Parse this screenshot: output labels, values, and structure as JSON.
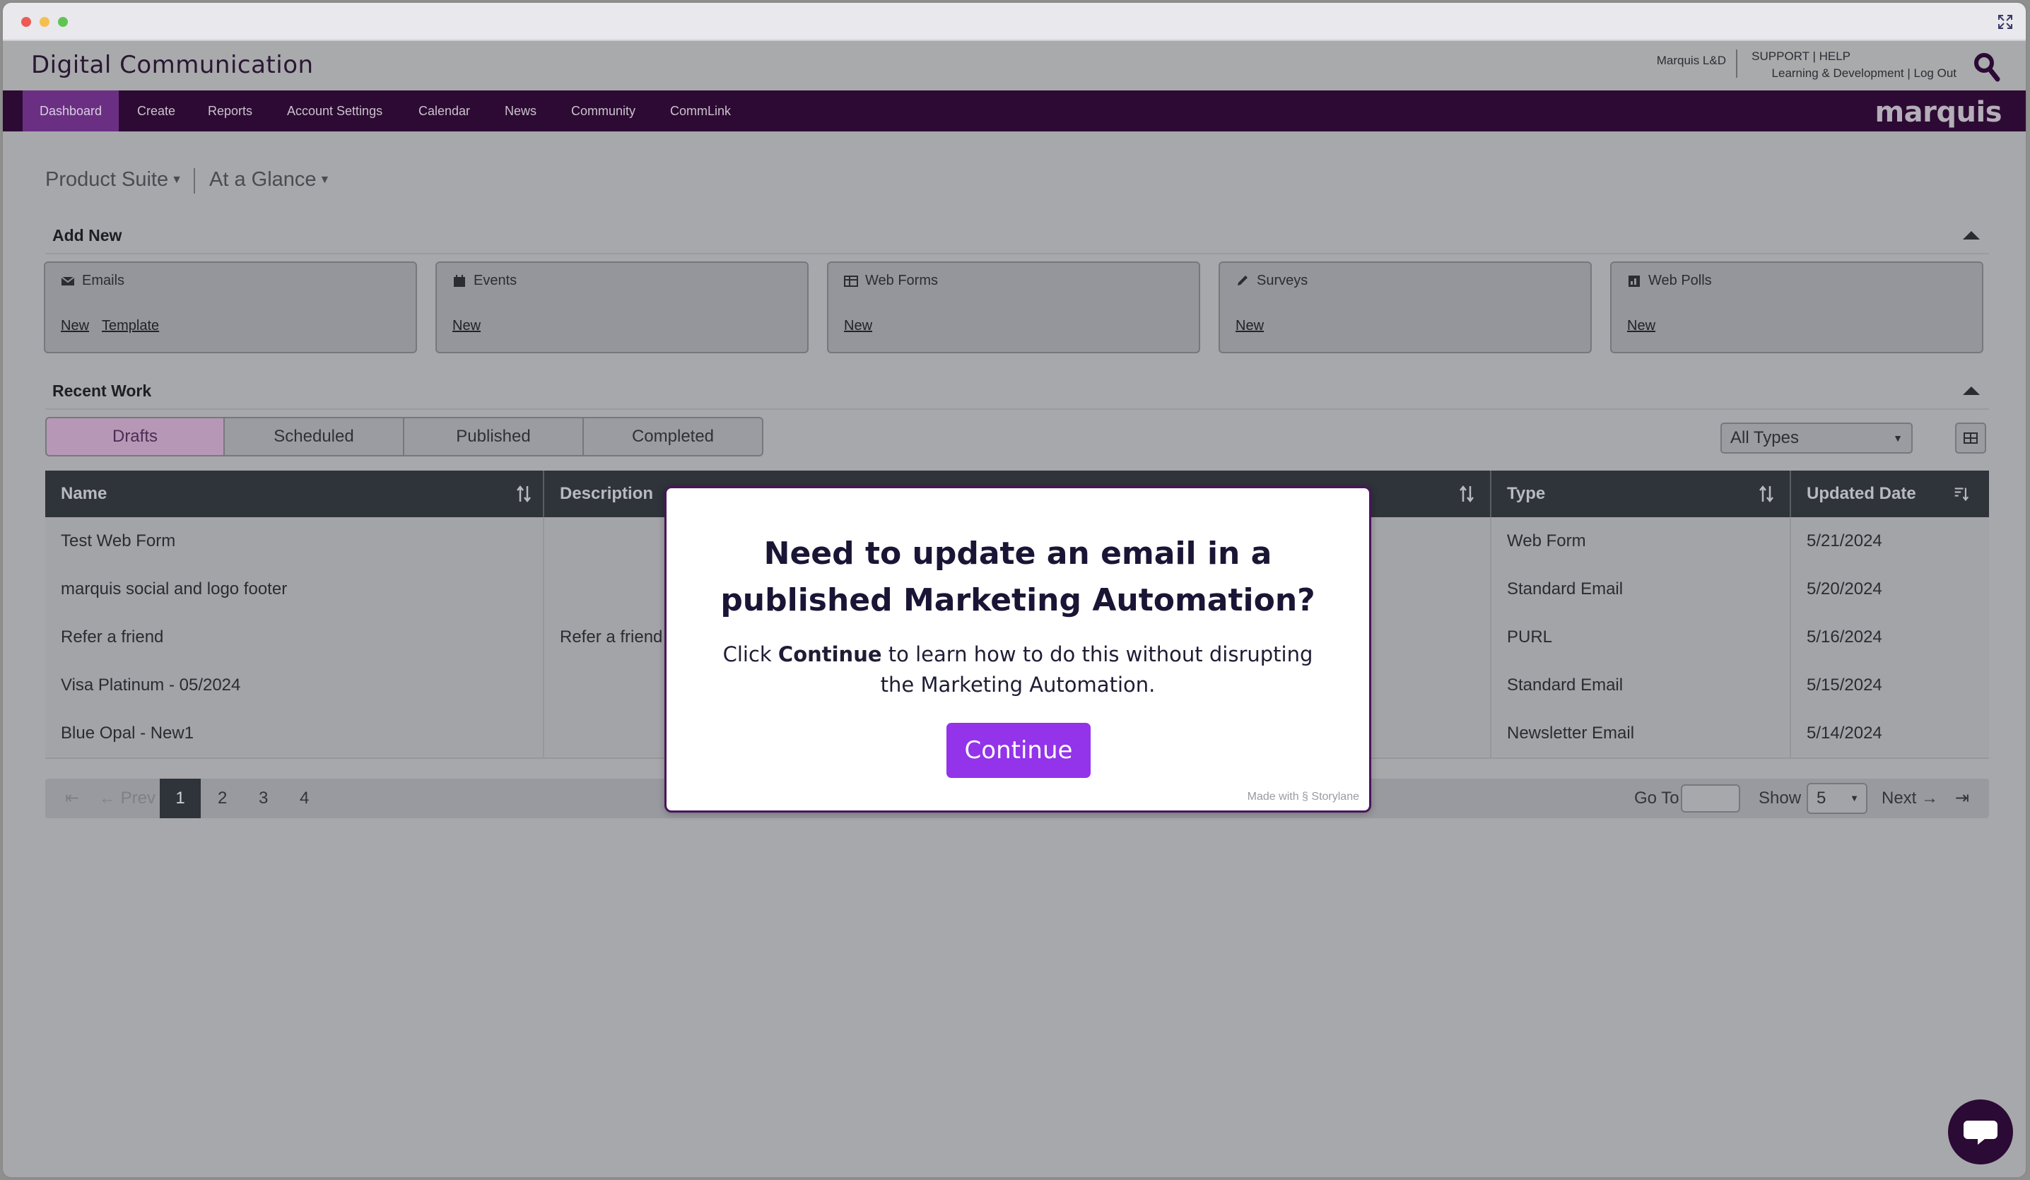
{
  "header": {
    "app_title": "Digital Communication",
    "user": "Marquis L&D",
    "support_links": "SUPPORT | HELP",
    "account_links": "Learning & Development | Log Out",
    "brand": "marquis"
  },
  "nav": {
    "items": [
      {
        "label": "Dashboard",
        "active": true
      },
      {
        "label": "Create"
      },
      {
        "label": "Reports"
      },
      {
        "label": "Account Settings"
      },
      {
        "label": "Calendar"
      },
      {
        "label": "News"
      },
      {
        "label": "Community"
      },
      {
        "label": "CommLink"
      }
    ]
  },
  "filters": {
    "product_suite": "Product Suite",
    "at_a_glance": "At a Glance"
  },
  "add_new": {
    "title": "Add New",
    "cards": [
      {
        "label": "Emails",
        "icon": "envelope-icon",
        "links": [
          "New",
          "Template"
        ]
      },
      {
        "label": "Events",
        "icon": "calendar-icon",
        "links": [
          "New"
        ]
      },
      {
        "label": "Web Forms",
        "icon": "table-icon",
        "links": [
          "New"
        ]
      },
      {
        "label": "Surveys",
        "icon": "pencil-icon",
        "links": [
          "New"
        ]
      },
      {
        "label": "Web Polls",
        "icon": "chart-icon",
        "links": [
          "New"
        ]
      }
    ]
  },
  "recent_work": {
    "title": "Recent Work",
    "tabs": [
      "Drafts",
      "Scheduled",
      "Published",
      "Completed"
    ],
    "type_filter": "All Types",
    "columns": [
      "Name",
      "Description",
      "Type",
      "Updated Date"
    ],
    "rows": [
      {
        "name": "Test Web Form",
        "description": "",
        "type": "Web Form",
        "date": "5/21/2024"
      },
      {
        "name": "marquis social and logo footer",
        "description": "",
        "type": "Standard Email",
        "date": "5/20/2024"
      },
      {
        "name": "Refer a friend",
        "description": "Refer a friend",
        "type": "PURL",
        "date": "5/16/2024"
      },
      {
        "name": "Visa Platinum - 05/2024",
        "description": "",
        "type": "Standard Email",
        "date": "5/15/2024"
      },
      {
        "name": "Blue Opal - New1",
        "description": "",
        "type": "Newsletter Email",
        "date": "5/14/2024"
      }
    ]
  },
  "pagination": {
    "prev": "Prev",
    "pages": [
      "1",
      "2",
      "3",
      "4"
    ],
    "current": "1",
    "goto_label": "Go To",
    "show_label": "Show",
    "show_value": "5",
    "next": "Next"
  },
  "modal": {
    "title_line1": "Need to update an email in a",
    "title_line2": "published Marketing Automation?",
    "body_pre": "Click ",
    "body_bold": "Continue",
    "body_post": " to learn how to do this without disrupting the Marketing Automation.",
    "button": "Continue",
    "made_with": "Made with",
    "made_with_brand": "Storylane"
  },
  "colors": {
    "nav_bg": "#2d0a33",
    "accent": "#9333ea",
    "modal_border": "#4a155d"
  }
}
